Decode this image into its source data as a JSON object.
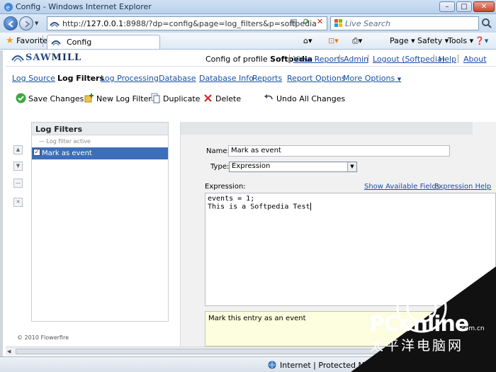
{
  "window": {
    "title": "Config - Windows Internet Explorer",
    "min": "–",
    "max": "□",
    "close": "✕"
  },
  "browser": {
    "url_prefix": "http://",
    "url_host": "127.0.0.1",
    "url_rest": ":8988/?dp=config&page=log_filters&p=softpedia",
    "search_placeholder": "Live Search",
    "favorites_label": "Favorites",
    "tab_title": "Config",
    "commands": {
      "page": "Page ▾",
      "safety": "Safety ▾",
      "tools": "Tools ▾",
      "help": "❓▾"
    },
    "status_zone": "Internet | Protected Mode: Off"
  },
  "header": {
    "logo_saw": "SAW",
    "logo_mill": "MILL",
    "profile_prefix": "Config of profile",
    "profile_name": "Softpedia",
    "links": [
      "View Reports",
      "Admin",
      "Logout (Softpedia)",
      "Help",
      "About"
    ]
  },
  "nav": {
    "log_source": "Log Source",
    "log_filters": "Log Filters",
    "log_processing": "Log Processing",
    "database": "Database",
    "database_info": "Database Info",
    "reports": "Reports",
    "report_options": "Report Options",
    "more_options": "More Options",
    "more_arrow": "▼"
  },
  "toolbar": {
    "save": "Save Changes",
    "new_filter": "New Log Filter",
    "duplicate": "Duplicate",
    "delete": "Delete",
    "undo": "Undo All Changes"
  },
  "left_panel": {
    "title": "Log Filters",
    "filter_active_label": "Log filter active",
    "items": [
      {
        "label": "Mark as event",
        "checked": "✓"
      }
    ],
    "side_buttons": [
      "▲",
      "▼",
      "—",
      "✕"
    ],
    "copyright": "© 2010 Flowerfire"
  },
  "editor": {
    "name_label": "Name:",
    "name_value": "Mark as event",
    "type_label": "Type:",
    "type_value": "Expression",
    "type_arrow": "▼",
    "expression_label": "Expression:",
    "show_fields_link": "Show Available Fields",
    "expression_help_link": "Expression Help",
    "expression_line1": "events = 1;",
    "expression_line2": "This is a Softpedia Test",
    "description": "Mark this entry as an event"
  },
  "watermark": {
    "brand": "PConline",
    "domain": ".com.cn",
    "cn": "太平洋电脑网"
  },
  "colors": {
    "link": "#1a4fa5",
    "selection": "#3d6fb8",
    "watermark": "#111111"
  }
}
